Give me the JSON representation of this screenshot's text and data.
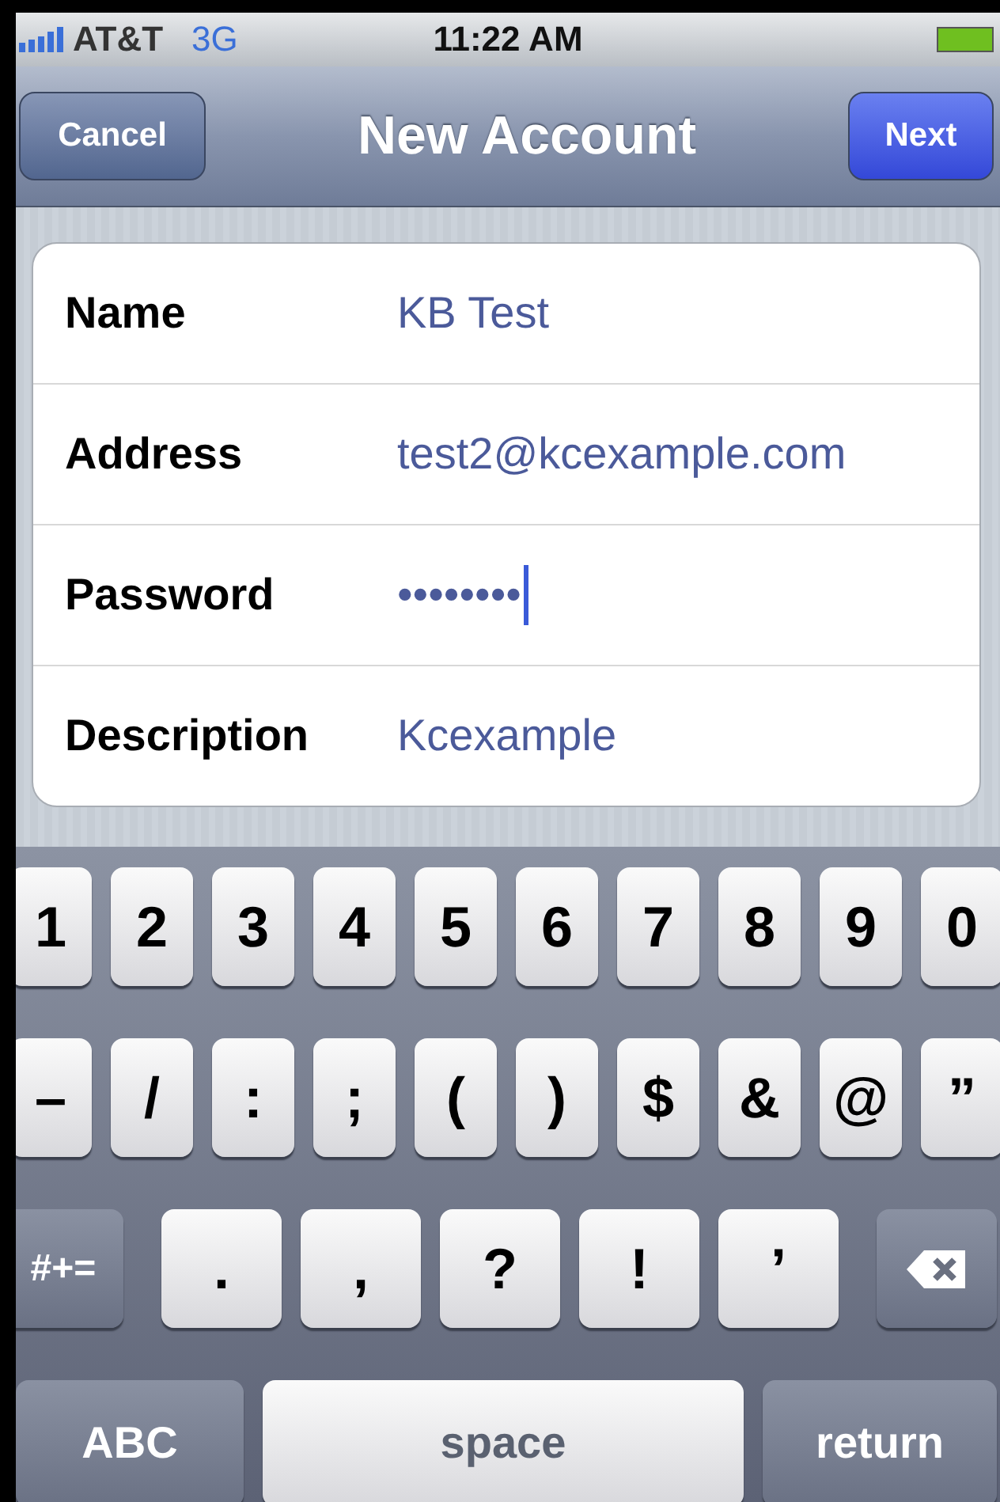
{
  "status_bar": {
    "carrier": "AT&T",
    "network": "3G",
    "time": "11:22 AM"
  },
  "nav_bar": {
    "left_button": "Cancel",
    "title": "New Account",
    "right_button": "Next"
  },
  "form": [
    {
      "label": "Name",
      "value": "KB Test",
      "focused": false
    },
    {
      "label": "Address",
      "value": "test2@kcexample.com",
      "focused": false
    },
    {
      "label": "Password",
      "value": "••••••••",
      "focused": true
    },
    {
      "label": "Description",
      "value": "Kcexample",
      "focused": false
    }
  ],
  "keyboard": [
    [
      {
        "kind": "char",
        "label": "1"
      },
      {
        "kind": "char",
        "label": "2"
      },
      {
        "kind": "char",
        "label": "3"
      },
      {
        "kind": "char",
        "label": "4"
      },
      {
        "kind": "char",
        "label": "5"
      },
      {
        "kind": "char",
        "label": "6"
      },
      {
        "kind": "char",
        "label": "7"
      },
      {
        "kind": "char",
        "label": "8"
      },
      {
        "kind": "char",
        "label": "9"
      },
      {
        "kind": "char",
        "label": "0"
      }
    ],
    [
      {
        "kind": "char",
        "label": "–"
      },
      {
        "kind": "char",
        "label": "/"
      },
      {
        "kind": "char",
        "label": ":"
      },
      {
        "kind": "char",
        "label": ";"
      },
      {
        "kind": "char",
        "label": "("
      },
      {
        "kind": "char",
        "label": ")"
      },
      {
        "kind": "char",
        "label": "$"
      },
      {
        "kind": "char",
        "label": "&"
      },
      {
        "kind": "char",
        "label": "@"
      },
      {
        "kind": "char",
        "label": "”"
      }
    ],
    [
      {
        "kind": "function",
        "label": "#+="
      },
      {
        "kind": "wide",
        "label": "."
      },
      {
        "kind": "wide",
        "label": ","
      },
      {
        "kind": "wide",
        "label": "?"
      },
      {
        "kind": "wide",
        "label": "!"
      },
      {
        "kind": "wide",
        "label": "’"
      },
      {
        "kind": "delete"
      }
    ],
    [
      {
        "kind": "bottom",
        "label": "ABC"
      },
      {
        "kind": "space",
        "label": "space"
      },
      {
        "kind": "bottom",
        "label": "return"
      }
    ]
  ]
}
